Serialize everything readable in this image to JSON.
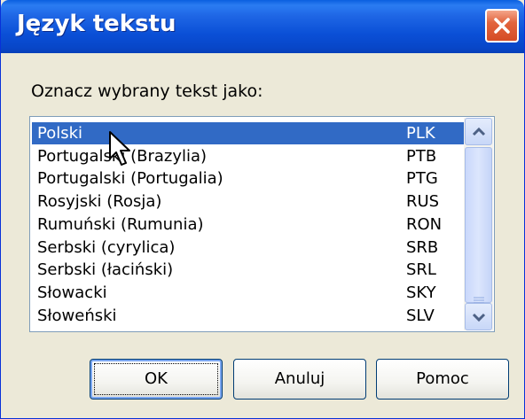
{
  "window": {
    "title": "Język tekstu"
  },
  "dialog": {
    "prompt": "Oznacz wybrany tekst jako:",
    "languages": [
      {
        "name": "Polski",
        "code": "PLK",
        "selected": true
      },
      {
        "name": "Portugalski (Brazylia)",
        "code": "PTB",
        "selected": false
      },
      {
        "name": "Portugalski (Portugalia)",
        "code": "PTG",
        "selected": false
      },
      {
        "name": "Rosyjski (Rosja)",
        "code": "RUS",
        "selected": false
      },
      {
        "name": "Rumuński (Rumunia)",
        "code": "RON",
        "selected": false
      },
      {
        "name": "Serbski (cyrylica)",
        "code": "SRB",
        "selected": false
      },
      {
        "name": "Serbski (łaciński)",
        "code": "SRL",
        "selected": false
      },
      {
        "name": "Słowacki",
        "code": "SKY",
        "selected": false
      },
      {
        "name": "Słoweński",
        "code": "SLV",
        "selected": false
      }
    ]
  },
  "buttons": {
    "ok": "OK",
    "cancel": "Anuluj",
    "help": "Pomoc"
  },
  "icons": {
    "close": "close-icon",
    "scroll_up": "scroll-up-icon",
    "scroll_down": "scroll-down-icon",
    "cursor": "mouse-pointer-icon"
  },
  "colors": {
    "titlebar": "#0a4fd6",
    "selection": "#316ac5",
    "close": "#d54c25"
  }
}
